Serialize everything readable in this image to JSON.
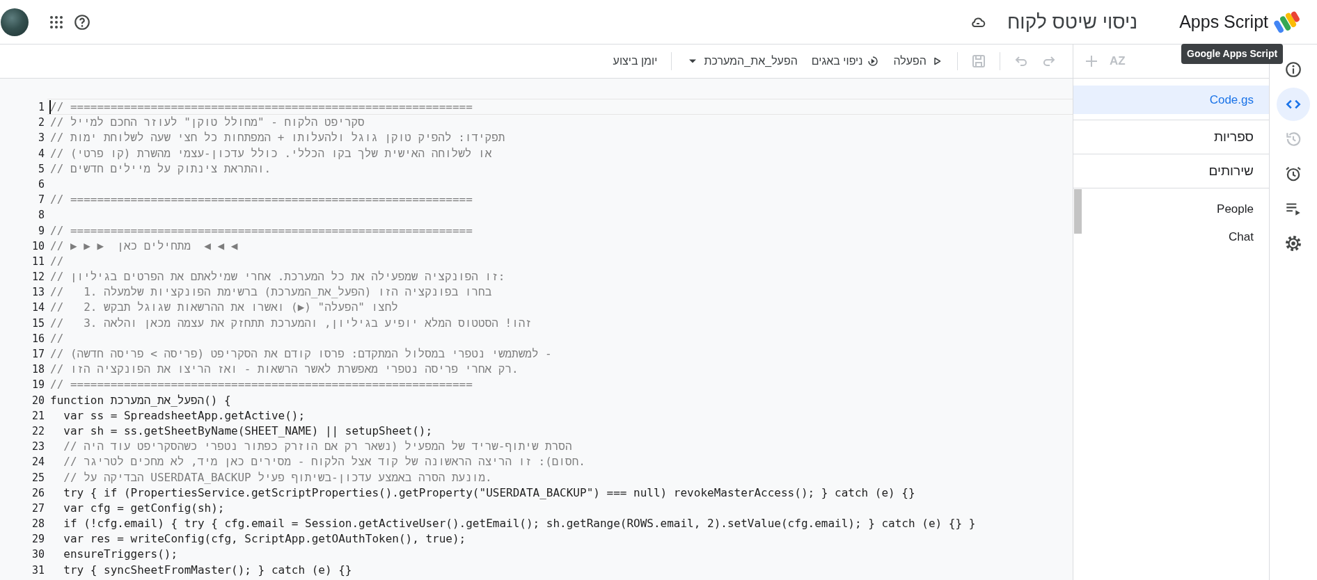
{
  "header": {
    "title": "ניסוי שיטס לקוח",
    "product": "Apps Script"
  },
  "tooltip": "Google Apps Script",
  "toolbar": [
    {
      "kind": "redo",
      "disabled": true
    },
    {
      "kind": "undo",
      "disabled": true
    },
    {
      "kind": "save",
      "disabled": true
    },
    {
      "kind": "run",
      "label": "הפעלה",
      "disabled": false
    },
    {
      "kind": "debug",
      "label": "ניפוי באגים",
      "disabled": false
    },
    {
      "kind": "function",
      "label": "הפעל_את_המערכת",
      "disabled": false
    },
    {
      "kind": "log",
      "label": "יומן ביצוע",
      "disabled": false
    }
  ],
  "files_panel": {
    "sort_label": "AZ",
    "files": [
      {
        "name": "Code.gs",
        "selected": true
      }
    ],
    "sections": [
      {
        "label": "ספריות"
      },
      {
        "label": "שירותים",
        "services": [
          "People",
          "Chat"
        ]
      }
    ]
  },
  "rail": [
    {
      "kind": "info",
      "selected": false,
      "disabled": false
    },
    {
      "kind": "code",
      "selected": true,
      "disabled": false
    },
    {
      "kind": "history",
      "selected": false,
      "disabled": true
    },
    {
      "kind": "triggers",
      "selected": false,
      "disabled": false
    },
    {
      "kind": "executions",
      "selected": false,
      "disabled": false
    },
    {
      "kind": "settings",
      "selected": false,
      "disabled": false
    }
  ],
  "editor": {
    "lines": [
      {
        "number": "1",
        "current": true,
        "indented": false,
        "kind": "comment",
        "text": "// ============================================================"
      },
      {
        "number": "2",
        "current": false,
        "indented": false,
        "kind": "comment",
        "text": "// סקריפט הלקוח - \"מחולל טוקן\" לעוזר החכם למייל"
      },
      {
        "number": "3",
        "current": false,
        "indented": false,
        "kind": "comment",
        "text": "// תפקידו: להפיק טוקן גוגל ולהעלותו + המפתחות כל חצי שעה לשלוחת ימות"
      },
      {
        "number": "4",
        "current": false,
        "indented": false,
        "kind": "comment",
        "text": "// או לשלוחה האישית שלך בקו הכללי. כולל עדכון-עצמי מהשרת (קו פרטי)"
      },
      {
        "number": "5",
        "current": false,
        "indented": false,
        "kind": "comment",
        "text": "// והתראת צינתוק על מיילים חדשים."
      },
      {
        "number": "6",
        "current": false
      },
      {
        "number": "7",
        "current": false,
        "indented": false,
        "kind": "comment",
        "text": "// ============================================================"
      },
      {
        "number": "8",
        "current": false
      },
      {
        "number": "9",
        "current": false,
        "indented": false,
        "kind": "comment",
        "text": "// ============================================================"
      },
      {
        "number": "10",
        "current": false,
        "indented": false,
        "kind": "comment",
        "text": "// ▶ ▶ ▶  מתחילים כאן  ◀ ◀ ◀"
      },
      {
        "number": "11",
        "current": false,
        "indented": false,
        "kind": "comment",
        "text": "//"
      },
      {
        "number": "12",
        "current": false,
        "indented": false,
        "kind": "comment",
        "text": "// זו הפונקציה שמפעילה את כל המערכת. אחרי שמילאתם את הפרטים בגיליון:"
      },
      {
        "number": "13",
        "current": false,
        "indented": false,
        "kind": "comment",
        "text": "//   1. בחרו בפונקציה הזו (הפעל_את_המערכת) ברשימת הפונקציות שלמעלה"
      },
      {
        "number": "14",
        "current": false,
        "indented": false,
        "kind": "comment",
        "text": "//   2. לחצו \"הפעלה\" (▶) ואשרו את ההרשאות שגוגל תבקש"
      },
      {
        "number": "15",
        "current": false,
        "indented": false,
        "kind": "comment",
        "text": "//   3. זהו! הסטטוס המלא יופיע בגיליון, והמערכת תתחזק את עצמה מכאן והלאה"
      },
      {
        "number": "16",
        "current": false,
        "indented": false,
        "kind": "comment",
        "text": "//"
      },
      {
        "number": "17",
        "current": false,
        "indented": false,
        "kind": "comment",
        "text": "// למשתמשי נטפרי במסלול המתקדם: פרסו קודם את הסקריפט (פריסה > פריסה חדשה) -"
      },
      {
        "number": "18",
        "current": false,
        "indented": false,
        "kind": "comment",
        "text": "// רק אחרי פריסה נטפרי מאפשרת לאשר הרשאות - ואז הריצו את הפונקציה הזו."
      },
      {
        "number": "19",
        "current": false,
        "indented": false,
        "kind": "comment",
        "text": "// ============================================================"
      },
      {
        "number": "20",
        "current": false,
        "indented": false,
        "kind": "code",
        "text": "function הפעל_את_המערכת() {"
      },
      {
        "number": "21",
        "current": false,
        "indented": true,
        "kind": "code",
        "text": "var ss = SpreadsheetApp.getActive();"
      },
      {
        "number": "22",
        "current": false,
        "indented": true,
        "kind": "code",
        "text": "var sh = ss.getSheetByName(SHEET_NAME) || setupSheet();"
      },
      {
        "number": "23",
        "current": false,
        "indented": true,
        "kind": "comment",
        "text": "// הסרת שיתוף-שריד של המפעיל (נשאר רק אם הוזרק כפתור נטפרי כשהסקריפט עוד היה"
      },
      {
        "number": "24",
        "current": false,
        "indented": true,
        "kind": "comment",
        "text": "// חסום): זו הריצה הראשונה של קוד אצל הלקוח - מסירים כאן מיד, לא מחכים לטריגר."
      },
      {
        "number": "25",
        "current": false,
        "indented": true,
        "kind": "comment",
        "text": "// הבדיקה על USERDATA_BACKUP מונעת הסרה באמצע עדכון-בשיתוף פעיל."
      },
      {
        "number": "26",
        "current": false,
        "indented": true,
        "kind": "code",
        "text": "try { if (PropertiesService.getScriptProperties().getProperty(\"USERDATA_BACKUP\") === null) revokeMasterAccess(); } catch (e) {}"
      },
      {
        "number": "27",
        "current": false,
        "indented": true,
        "kind": "code",
        "text": "var cfg = getConfig(sh);"
      },
      {
        "number": "28",
        "current": false,
        "indented": true,
        "kind": "code",
        "text": "if (!cfg.email) { try { cfg.email = Session.getActiveUser().getEmail(); sh.getRange(ROWS.email, 2).setValue(cfg.email); } catch (e) {} }"
      },
      {
        "number": "29",
        "current": false,
        "indented": true,
        "kind": "code",
        "text": "var res = writeConfig(cfg, ScriptApp.getOAuthToken(), true);"
      },
      {
        "number": "30",
        "current": false,
        "indented": true,
        "kind": "code",
        "text": "ensureTriggers();"
      },
      {
        "number": "31",
        "current": false,
        "indented": true,
        "kind": "code",
        "text": "try { syncSheetFromMaster(); } catch (e) {}"
      }
    ]
  }
}
